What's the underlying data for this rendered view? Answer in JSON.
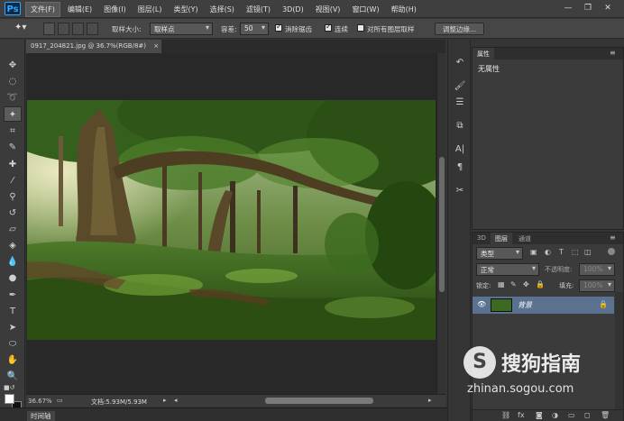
{
  "app": {
    "logo": "Ps"
  },
  "menu": [
    "文件(F)",
    "编辑(E)",
    "图像(I)",
    "图层(L)",
    "类型(Y)",
    "选择(S)",
    "滤镜(T)",
    "3D(D)",
    "视图(V)",
    "窗口(W)",
    "帮助(H)"
  ],
  "options": {
    "sample_size_label": "取样大小:",
    "sample_size_value": "取样点",
    "tolerance_label": "容差:",
    "tolerance_value": "50",
    "antialias_label": "消除锯齿",
    "contiguous_label": "连续",
    "sample_all_label": "对所有图层取样",
    "refine_edge_label": "调整边缘..."
  },
  "document": {
    "tab_title": "0917_204821.jpg @ 36.7%(RGB/8#)",
    "zoom": "36.67%",
    "doc_size": "文档:5.93M/5.93M"
  },
  "timeline": {
    "label": "时间轴"
  },
  "properties": {
    "tab": "属性",
    "content": "无属性"
  },
  "layers": {
    "tabs": [
      "3D",
      "图层",
      "通道"
    ],
    "filter_kind": "类型",
    "blend_mode": "正常",
    "opacity_label": "不透明度:",
    "opacity_value": "100%",
    "lock_label": "锁定:",
    "fill_label": "填充:",
    "fill_value": "100%",
    "layer_name": "背景"
  },
  "watermark": {
    "brand": "搜狗指南",
    "url": "zhinan.sogou.com"
  },
  "colors": {
    "accent": "#31a8ff",
    "selected_layer": "#5b7190"
  }
}
